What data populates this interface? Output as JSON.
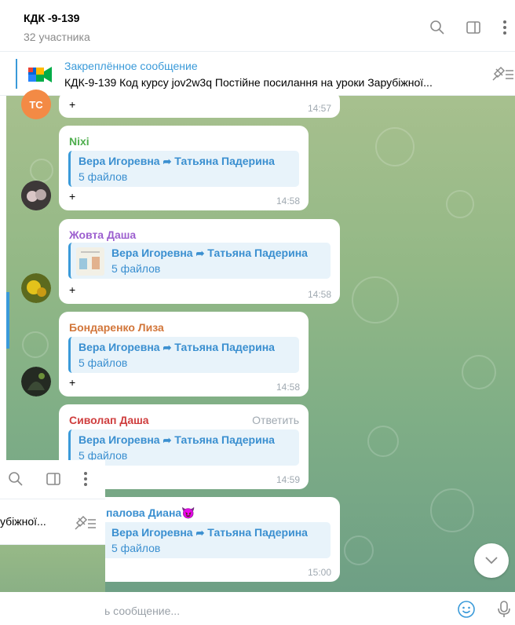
{
  "header": {
    "title": "КДК -9-139",
    "subtitle": "32 участника",
    "icons": [
      "search-icon",
      "sidebar-toggle-icon",
      "more-vertical-icon"
    ]
  },
  "pinned": {
    "title": "Закреплённое сообщение",
    "text": "КДК-9-139  Код курсу  jov2w3q  Постійне посилання на уроки Зарубіжної...",
    "icon": "pin-list-icon"
  },
  "messages": [
    {
      "sender": "",
      "text": "+",
      "time": "14:57"
    },
    {
      "sender": "Nixi",
      "sender_color": "#4fae4e",
      "forward_from": "Вера Игоревна",
      "forward_to": "Татьяна Падерина",
      "files": "5 файлов",
      "text": "+",
      "time": "14:58"
    },
    {
      "sender": "Жовта Даша",
      "sender_color": "#9c5fcf",
      "forward_from": "Вера Игоревна",
      "forward_to": "Татьяна Падерина",
      "files": "5 файлов",
      "text": "+",
      "time": "14:58"
    },
    {
      "sender": "Бондаренко Лиза",
      "sender_color": "#d2763a",
      "forward_from": "Вера Игоревна",
      "forward_to": "Татьяна Падерина",
      "files": "5 файлов",
      "text": "+",
      "time": "14:58"
    },
    {
      "sender": "Сиволап Даша",
      "sender_color": "#cf3e3e",
      "reply_label": "Ответить",
      "forward_from": "Вера Игоревна",
      "forward_to": "Татьяна Падерина",
      "files": "5 файлов",
      "time": "14:59"
    },
    {
      "sender": "палова Диана😈",
      "sender_color": "#3a8fd0",
      "forward_from": "Вера Игоревна",
      "forward_to": "Татьяна Падерина",
      "files": "5 файлов",
      "time": "15:00"
    }
  ],
  "avatars": {
    "tc_initials": "TC"
  },
  "composer": {
    "placeholder": "ь сообщение...",
    "icons": [
      "emoji-icon",
      "microphone-icon"
    ]
  },
  "fragment": {
    "pinned_text": "убіжної...",
    "placeholder": ""
  },
  "colors": {
    "accent": "#3a9ad9",
    "brand_red": "#c8102e"
  }
}
